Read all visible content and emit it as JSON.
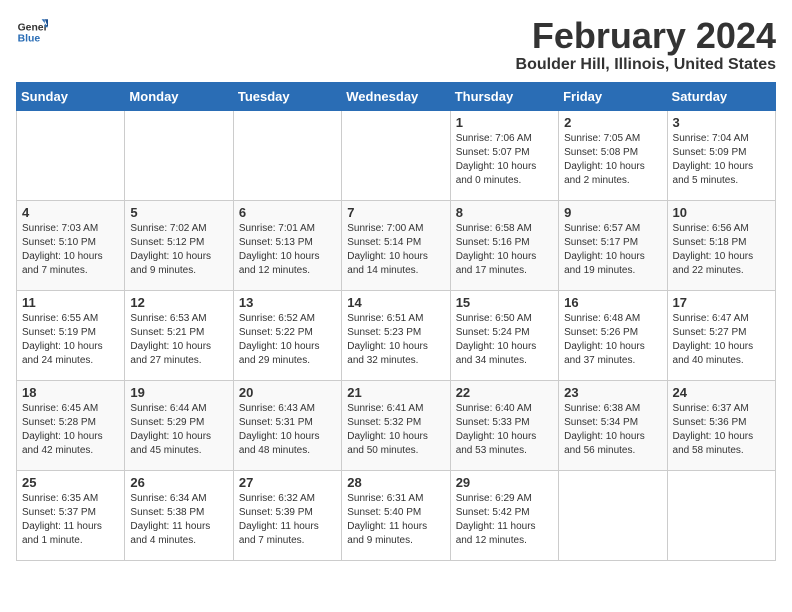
{
  "header": {
    "logo_general": "General",
    "logo_blue": "Blue",
    "title": "February 2024",
    "subtitle": "Boulder Hill, Illinois, United States"
  },
  "days_of_week": [
    "Sunday",
    "Monday",
    "Tuesday",
    "Wednesday",
    "Thursday",
    "Friday",
    "Saturday"
  ],
  "weeks": [
    {
      "days": [
        {
          "num": "",
          "info": ""
        },
        {
          "num": "",
          "info": ""
        },
        {
          "num": "",
          "info": ""
        },
        {
          "num": "",
          "info": ""
        },
        {
          "num": "1",
          "info": "Sunrise: 7:06 AM\nSunset: 5:07 PM\nDaylight: 10 hours\nand 0 minutes."
        },
        {
          "num": "2",
          "info": "Sunrise: 7:05 AM\nSunset: 5:08 PM\nDaylight: 10 hours\nand 2 minutes."
        },
        {
          "num": "3",
          "info": "Sunrise: 7:04 AM\nSunset: 5:09 PM\nDaylight: 10 hours\nand 5 minutes."
        }
      ]
    },
    {
      "days": [
        {
          "num": "4",
          "info": "Sunrise: 7:03 AM\nSunset: 5:10 PM\nDaylight: 10 hours\nand 7 minutes."
        },
        {
          "num": "5",
          "info": "Sunrise: 7:02 AM\nSunset: 5:12 PM\nDaylight: 10 hours\nand 9 minutes."
        },
        {
          "num": "6",
          "info": "Sunrise: 7:01 AM\nSunset: 5:13 PM\nDaylight: 10 hours\nand 12 minutes."
        },
        {
          "num": "7",
          "info": "Sunrise: 7:00 AM\nSunset: 5:14 PM\nDaylight: 10 hours\nand 14 minutes."
        },
        {
          "num": "8",
          "info": "Sunrise: 6:58 AM\nSunset: 5:16 PM\nDaylight: 10 hours\nand 17 minutes."
        },
        {
          "num": "9",
          "info": "Sunrise: 6:57 AM\nSunset: 5:17 PM\nDaylight: 10 hours\nand 19 minutes."
        },
        {
          "num": "10",
          "info": "Sunrise: 6:56 AM\nSunset: 5:18 PM\nDaylight: 10 hours\nand 22 minutes."
        }
      ]
    },
    {
      "days": [
        {
          "num": "11",
          "info": "Sunrise: 6:55 AM\nSunset: 5:19 PM\nDaylight: 10 hours\nand 24 minutes."
        },
        {
          "num": "12",
          "info": "Sunrise: 6:53 AM\nSunset: 5:21 PM\nDaylight: 10 hours\nand 27 minutes."
        },
        {
          "num": "13",
          "info": "Sunrise: 6:52 AM\nSunset: 5:22 PM\nDaylight: 10 hours\nand 29 minutes."
        },
        {
          "num": "14",
          "info": "Sunrise: 6:51 AM\nSunset: 5:23 PM\nDaylight: 10 hours\nand 32 minutes."
        },
        {
          "num": "15",
          "info": "Sunrise: 6:50 AM\nSunset: 5:24 PM\nDaylight: 10 hours\nand 34 minutes."
        },
        {
          "num": "16",
          "info": "Sunrise: 6:48 AM\nSunset: 5:26 PM\nDaylight: 10 hours\nand 37 minutes."
        },
        {
          "num": "17",
          "info": "Sunrise: 6:47 AM\nSunset: 5:27 PM\nDaylight: 10 hours\nand 40 minutes."
        }
      ]
    },
    {
      "days": [
        {
          "num": "18",
          "info": "Sunrise: 6:45 AM\nSunset: 5:28 PM\nDaylight: 10 hours\nand 42 minutes."
        },
        {
          "num": "19",
          "info": "Sunrise: 6:44 AM\nSunset: 5:29 PM\nDaylight: 10 hours\nand 45 minutes."
        },
        {
          "num": "20",
          "info": "Sunrise: 6:43 AM\nSunset: 5:31 PM\nDaylight: 10 hours\nand 48 minutes."
        },
        {
          "num": "21",
          "info": "Sunrise: 6:41 AM\nSunset: 5:32 PM\nDaylight: 10 hours\nand 50 minutes."
        },
        {
          "num": "22",
          "info": "Sunrise: 6:40 AM\nSunset: 5:33 PM\nDaylight: 10 hours\nand 53 minutes."
        },
        {
          "num": "23",
          "info": "Sunrise: 6:38 AM\nSunset: 5:34 PM\nDaylight: 10 hours\nand 56 minutes."
        },
        {
          "num": "24",
          "info": "Sunrise: 6:37 AM\nSunset: 5:36 PM\nDaylight: 10 hours\nand 58 minutes."
        }
      ]
    },
    {
      "days": [
        {
          "num": "25",
          "info": "Sunrise: 6:35 AM\nSunset: 5:37 PM\nDaylight: 11 hours\nand 1 minute."
        },
        {
          "num": "26",
          "info": "Sunrise: 6:34 AM\nSunset: 5:38 PM\nDaylight: 11 hours\nand 4 minutes."
        },
        {
          "num": "27",
          "info": "Sunrise: 6:32 AM\nSunset: 5:39 PM\nDaylight: 11 hours\nand 7 minutes."
        },
        {
          "num": "28",
          "info": "Sunrise: 6:31 AM\nSunset: 5:40 PM\nDaylight: 11 hours\nand 9 minutes."
        },
        {
          "num": "29",
          "info": "Sunrise: 6:29 AM\nSunset: 5:42 PM\nDaylight: 11 hours\nand 12 minutes."
        },
        {
          "num": "",
          "info": ""
        },
        {
          "num": "",
          "info": ""
        }
      ]
    }
  ]
}
